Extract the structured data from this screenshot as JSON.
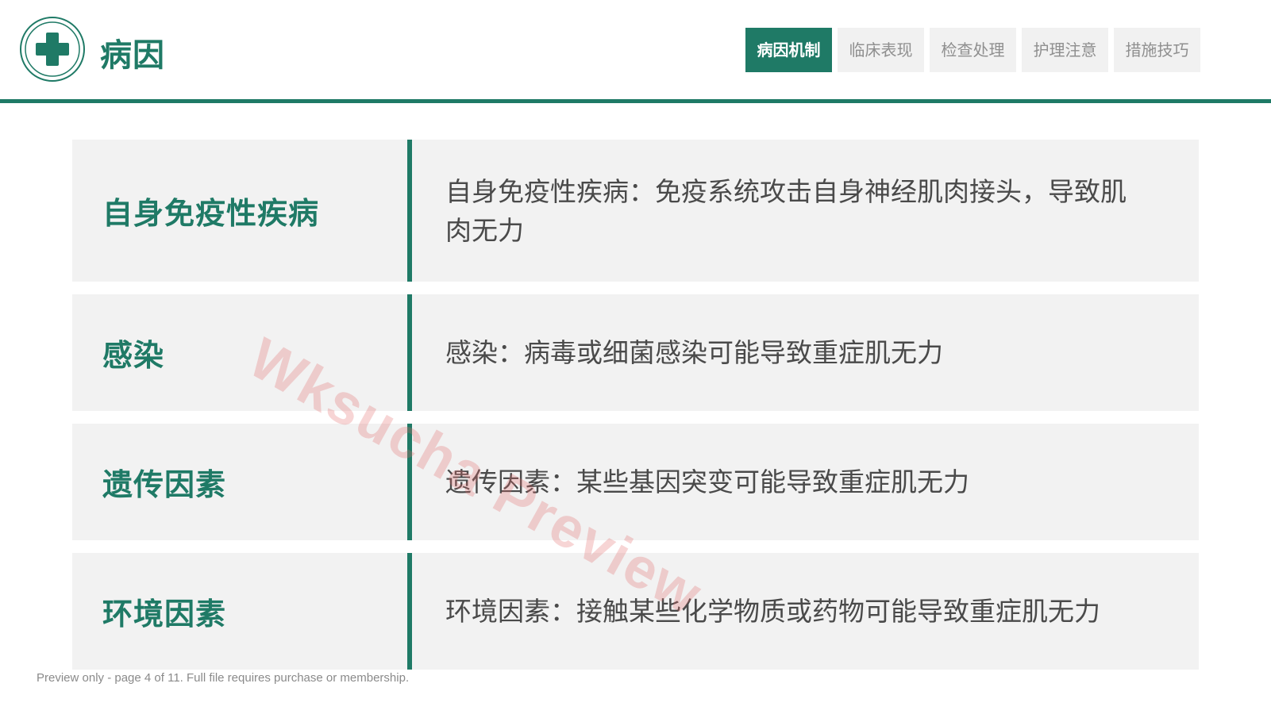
{
  "header": {
    "title": "病因",
    "logo_icon": "medical-cross-icon",
    "tabs": [
      {
        "label": "病因机制",
        "active": true
      },
      {
        "label": "临床表现",
        "active": false
      },
      {
        "label": "检查处理",
        "active": false
      },
      {
        "label": "护理注意",
        "active": false
      },
      {
        "label": "措施技巧",
        "active": false
      }
    ]
  },
  "rows": [
    {
      "label": "自身免疫性疾病",
      "desc": "自身免疫性疾病：免疫系统攻击自身神经肌肉接头，导致肌肉无力"
    },
    {
      "label": "感染",
      "desc": "感染：病毒或细菌感染可能导致重症肌无力"
    },
    {
      "label": "遗传因素",
      "desc": "遗传因素：某些基因突变可能导致重症肌无力"
    },
    {
      "label": "环境因素",
      "desc": "环境因素：接触某些化学物质或药物可能导致重症肌无力"
    }
  ],
  "watermark": "Wksucha Preview",
  "footer_note": "Preview only - page 4 of 11. Full file requires purchase or membership.",
  "colors": {
    "accent": "#1f7a66",
    "panel": "#f2f2f2",
    "tab_inactive": "#f1f1f1",
    "watermark": "#e16969"
  }
}
